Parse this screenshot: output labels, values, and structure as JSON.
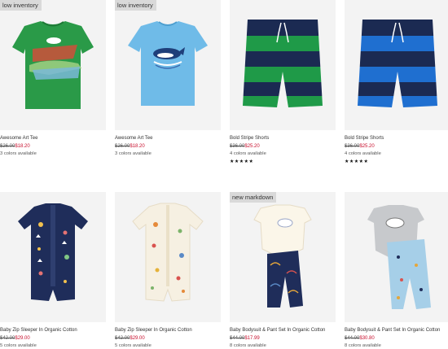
{
  "products": [
    {
      "badge": "low inventory",
      "title": "Awesome Art Tee",
      "original_price": "$26.00",
      "sale_price": "$18.20",
      "colors": "3 colors available",
      "rating_stars": "",
      "image": "green-tee-crocodile"
    },
    {
      "badge": "low inventory",
      "title": "Awesome Art Tee",
      "original_price": "$26.00",
      "sale_price": "$18.20",
      "colors": "3 colors available",
      "rating_stars": "",
      "image": "blue-tee-whale"
    },
    {
      "badge": "",
      "title": "Bold Stripe Shorts",
      "original_price": "$36.00",
      "sale_price": "$25.20",
      "colors": "4 colors available",
      "rating_stars": "★★★★★",
      "image": "green-navy-stripe-shorts"
    },
    {
      "badge": "",
      "title": "Bold Stripe Shorts",
      "original_price": "$36.00",
      "sale_price": "$25.20",
      "colors": "4 colors available",
      "rating_stars": "★★★★★",
      "image": "blue-navy-stripe-shorts"
    },
    {
      "badge": "",
      "title": "Baby Zip Sleeper In Organic Cotton",
      "original_price": "$42.00",
      "sale_price": "$29.00",
      "colors": "5 colors available",
      "rating_stars": "",
      "image": "navy-space-sleeper"
    },
    {
      "badge": "",
      "title": "Baby Zip Sleeper In Organic Cotton",
      "original_price": "$42.00",
      "sale_price": "$29.00",
      "colors": "5 colors available",
      "rating_stars": "",
      "image": "cream-print-sleeper"
    },
    {
      "badge": "new markdown",
      "title": "Baby Bodysuit & Pant Set In Organic Cotton",
      "original_price": "$44.00",
      "sale_price": "$17.99",
      "colors": "8 colors available",
      "rating_stars": "",
      "image": "cream-navy-bodysuit-set"
    },
    {
      "badge": "",
      "title": "Baby Bodysuit & Pant Set In Organic Cotton",
      "original_price": "$44.00",
      "sale_price": "$30.80",
      "colors": "8 colors available",
      "rating_stars": "",
      "image": "grey-blue-bodysuit-set"
    }
  ],
  "colors": {
    "sale": "#c8102e",
    "badge_bg": "#d9d9d9",
    "photo_bg": "#f3f3f3"
  }
}
